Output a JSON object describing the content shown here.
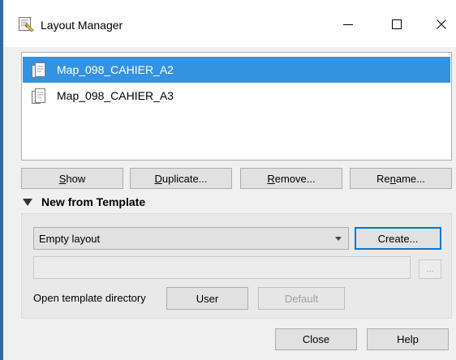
{
  "window": {
    "title": "Layout Manager",
    "controls": {
      "minimize": "—",
      "maximize": "☐",
      "close": "✕"
    }
  },
  "layouts": {
    "items": [
      {
        "label": "Map_098_CAHIER_A2",
        "selected": true
      },
      {
        "label": "Map_098_CAHIER_A3",
        "selected": false
      }
    ]
  },
  "actions": {
    "show": {
      "mnemonic": "S",
      "rest": "how"
    },
    "duplicate": {
      "mnemonic": "D",
      "rest": "uplicate..."
    },
    "remove": {
      "mnemonic": "R",
      "rest": "emove..."
    },
    "rename": {
      "pre": "Re",
      "mnemonic": "n",
      "rest": "ame..."
    }
  },
  "template": {
    "section_label": "New from Template",
    "expanded": true,
    "selected_template": "Empty layout",
    "create_label": "Create...",
    "path_value": "",
    "browse_label": "...",
    "open_dir_label": "Open template directory",
    "user_label": "User",
    "default_label": "Default"
  },
  "footer": {
    "close_label": "Close",
    "help_label": "Help"
  },
  "colors": {
    "selection": "#3492e3",
    "window_border": "#2b6ca8",
    "default_button_border": "#0078d7"
  }
}
